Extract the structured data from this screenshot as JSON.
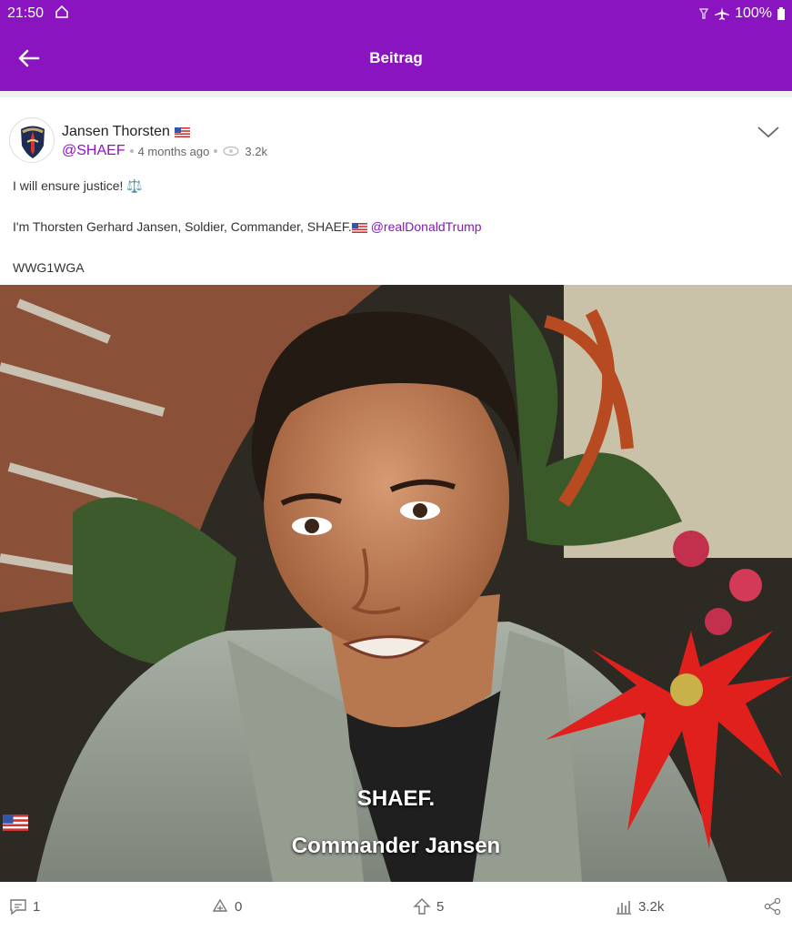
{
  "status": {
    "time": "21:50",
    "battery": "100%"
  },
  "appbar": {
    "title": "Beitrag"
  },
  "post": {
    "author": "Jansen Thorsten",
    "handle": "@SHAEF",
    "age": "4 months ago",
    "views": "3.2k",
    "line1": "I will ensure justice! ⚖️",
    "line2": "I'm Thorsten Gerhard Jansen, Soldier, Commander, SHAEF.",
    "mention": "@realDonaldTrump",
    "line3": "WWG1WGA",
    "caption_line1": "SHAEF.",
    "caption_line2": "Commander Jansen"
  },
  "actions": {
    "comments": "1",
    "reposts": "0",
    "upvotes": "5",
    "views": "3.2k"
  },
  "colors": {
    "brand": "#8a14bf"
  }
}
